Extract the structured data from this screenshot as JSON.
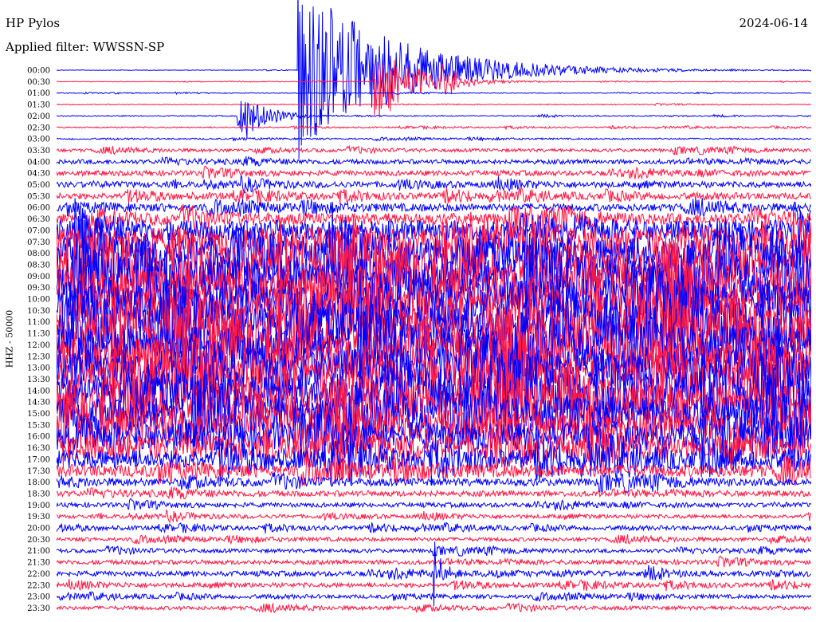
{
  "header": {
    "station": "HP Pylos",
    "date": "2024-06-14",
    "filter": "Applied filter: WWSSN-SP"
  },
  "chart_data": {
    "type": "line",
    "title": "HP Pylos",
    "subtitle": "Applied filter: WWSSN-SP",
    "ylabel": "HHZ - 50000",
    "date": "2024-06-14",
    "row_times": [
      "00:00",
      "00:30",
      "01:00",
      "01:30",
      "02:00",
      "02:30",
      "03:00",
      "03:30",
      "04:00",
      "04:30",
      "05:00",
      "05:30",
      "06:00",
      "06:30",
      "07:00",
      "07:30",
      "08:00",
      "08:30",
      "09:00",
      "09:30",
      "10:00",
      "10:30",
      "11:00",
      "11:30",
      "12:00",
      "12:30",
      "13:00",
      "13:30",
      "14:00",
      "14:30",
      "15:00",
      "15:30",
      "16:00",
      "16:30",
      "17:00",
      "17:30",
      "18:00",
      "18:30",
      "19:00",
      "19:30",
      "20:00",
      "20:30",
      "21:00",
      "21:30",
      "22:00",
      "22:30",
      "23:00",
      "23:30"
    ],
    "row_colors": [
      "#0000ff",
      "#ff1744"
    ],
    "noise_levels": [
      0.04,
      0.05,
      0.06,
      0.07,
      0.08,
      0.1,
      0.12,
      0.25,
      0.35,
      0.4,
      0.45,
      0.5,
      0.6,
      0.9,
      1.6,
      2.2,
      2.6,
      2.8,
      3.0,
      3.0,
      3.0,
      3.1,
      3.2,
      3.2,
      3.1,
      3.0,
      3.0,
      3.0,
      2.9,
      2.8,
      2.7,
      2.5,
      2.2,
      1.9,
      1.5,
      1.0,
      0.6,
      0.45,
      0.35,
      0.3,
      0.32,
      0.3,
      0.3,
      0.35,
      0.4,
      0.35,
      0.3,
      0.3
    ],
    "events": [
      {
        "row": 0,
        "time_frac": 0.32,
        "amplitude": 8,
        "decay": 0.12,
        "label": ""
      },
      {
        "row": 1,
        "time_frac": 0.42,
        "amplitude": 4,
        "decay": 0.05,
        "label": ""
      },
      {
        "row": 4,
        "time_frac": 0.24,
        "amplitude": 3,
        "decay": 0.03,
        "label": ""
      },
      {
        "row": 1,
        "time_frac": 0.51,
        "amplitude": 1.5,
        "decay": 0.02,
        "label": ""
      },
      {
        "row": 44,
        "time_frac": 0.5,
        "amplitude": 3,
        "decay": 0.01,
        "label": ""
      }
    ]
  }
}
